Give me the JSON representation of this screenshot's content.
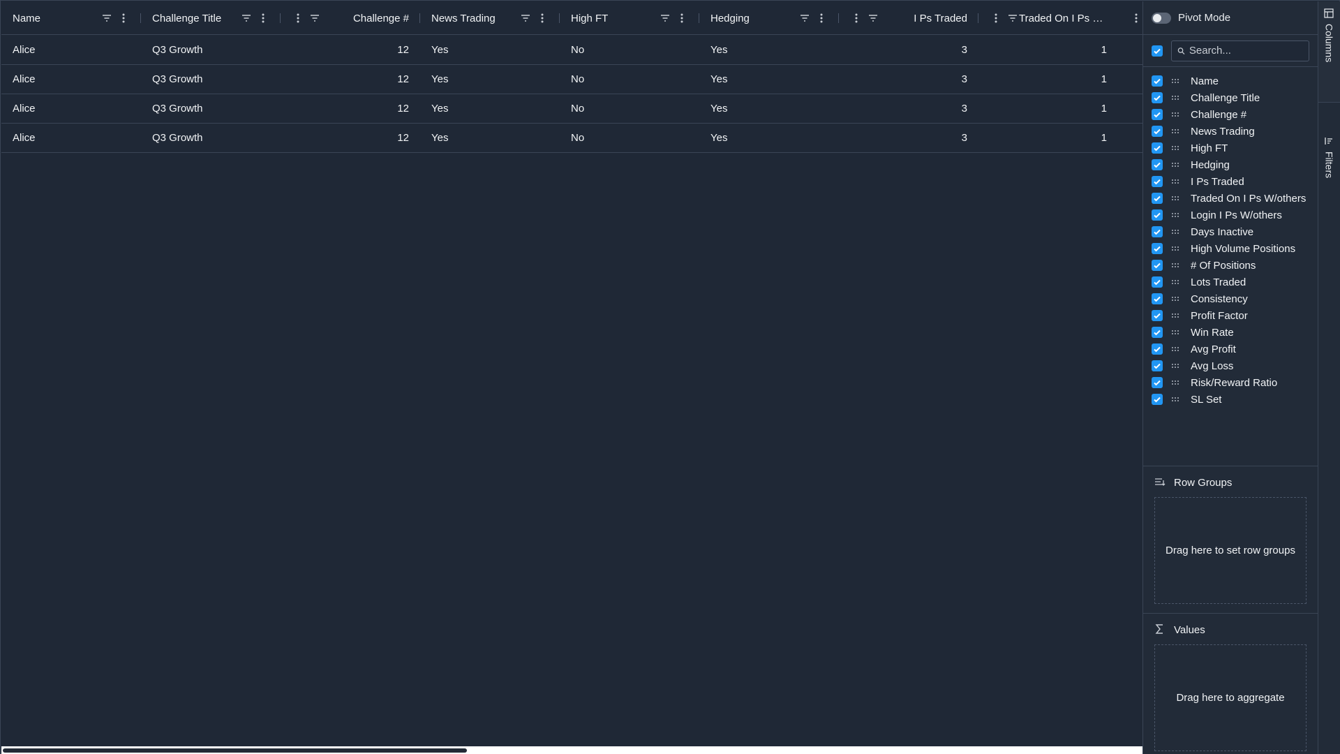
{
  "columns": [
    {
      "label": "Name"
    },
    {
      "label": "Challenge Title"
    },
    {
      "label": "Challenge #"
    },
    {
      "label": "News Trading"
    },
    {
      "label": "High FT"
    },
    {
      "label": "Hedging"
    },
    {
      "label": "I Ps Traded"
    },
    {
      "label": "Traded On I Ps W..."
    }
  ],
  "rows": [
    {
      "name": "Alice",
      "title": "Q3 Growth",
      "num": "12",
      "news": "Yes",
      "hft": "No",
      "hedging": "Yes",
      "ips": "3",
      "traded": "1"
    },
    {
      "name": "Alice",
      "title": "Q3 Growth",
      "num": "12",
      "news": "Yes",
      "hft": "No",
      "hedging": "Yes",
      "ips": "3",
      "traded": "1"
    },
    {
      "name": "Alice",
      "title": "Q3 Growth",
      "num": "12",
      "news": "Yes",
      "hft": "No",
      "hedging": "Yes",
      "ips": "3",
      "traded": "1"
    },
    {
      "name": "Alice",
      "title": "Q3 Growth",
      "num": "12",
      "news": "Yes",
      "hft": "No",
      "hedging": "Yes",
      "ips": "3",
      "traded": "1"
    }
  ],
  "side": {
    "pivot_label": "Pivot Mode",
    "search_placeholder": "Search...",
    "columns_list": [
      "Name",
      "Challenge Title",
      "Challenge #",
      "News Trading",
      "High FT",
      "Hedging",
      "I Ps Traded",
      "Traded On I Ps W/others",
      "Login I Ps W/others",
      "Days Inactive",
      "High Volume Positions",
      "# Of Positions",
      "Lots Traded",
      "Consistency",
      "Profit Factor",
      "Win Rate",
      "Avg Profit",
      "Avg Loss",
      "Risk/Reward Ratio",
      "SL Set"
    ],
    "row_groups_title": "Row Groups",
    "row_groups_drop": "Drag here to set row groups",
    "values_title": "Values",
    "values_drop": "Drag here to aggregate"
  },
  "tabs": {
    "columns": "Columns",
    "filters": "Filters"
  },
  "colors": {
    "background": "#1f2836",
    "panel": "#222b38",
    "accent": "#2196f3",
    "border": "#3a4556"
  }
}
